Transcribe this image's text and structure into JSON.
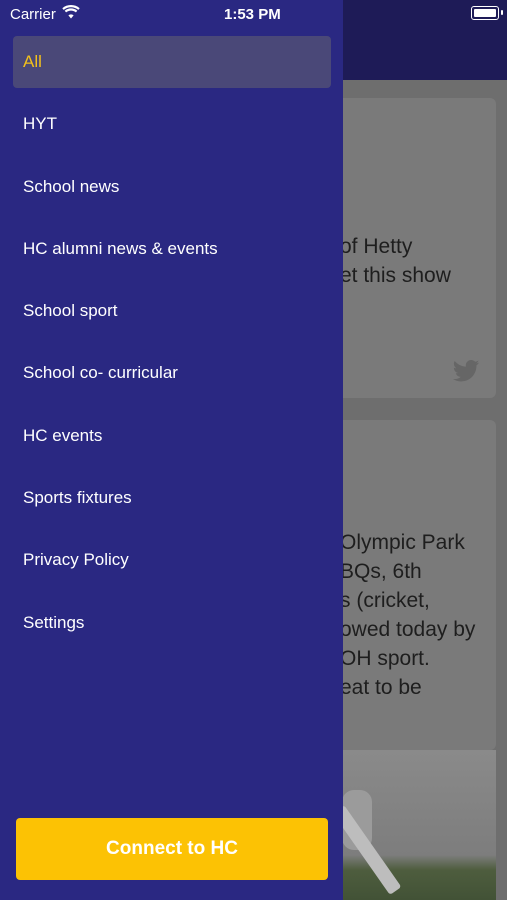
{
  "status_bar": {
    "carrier": "Carrier",
    "time": "1:53 PM"
  },
  "menu": {
    "items": [
      {
        "label": "All",
        "active": true
      },
      {
        "label": "HYT"
      },
      {
        "label": "School news"
      },
      {
        "label": "HC alumni news & events"
      },
      {
        "label": "School sport"
      },
      {
        "label": "School co- curricular"
      },
      {
        "label": "HC events"
      },
      {
        "label": "Sports fixtures"
      },
      {
        "label": "Privacy Policy"
      },
      {
        "label": "Settings"
      }
    ],
    "connect_label": "Connect to HC"
  },
  "feed": {
    "card1_text": "of Hetty\net this show",
    "card2_text": "Olympic Park\nBQs, 6th\ns (cricket,\nowed today by\nOH sport.\neat to be"
  },
  "colors": {
    "drawer": "#2a2882",
    "active_text": "#f2c01c",
    "connect_button": "#fcc204"
  }
}
